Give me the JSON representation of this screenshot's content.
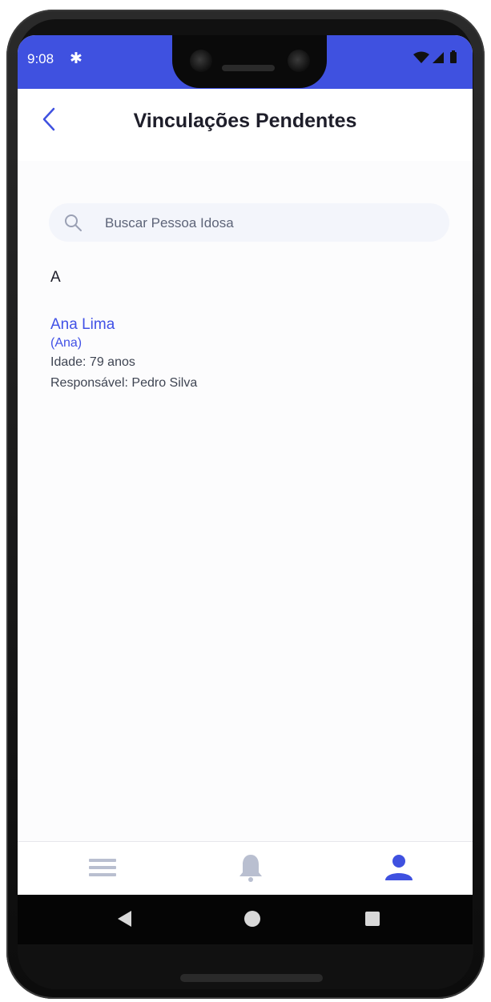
{
  "status_bar": {
    "time": "9:08",
    "settings_icon": "gear-icon",
    "right_icons": [
      "wifi-icon",
      "signal-icon",
      "battery-icon"
    ]
  },
  "header": {
    "title": "Vinculações Pendentes",
    "back_icon": "chevron-left-icon"
  },
  "search": {
    "placeholder": "Buscar Pessoa Idosa",
    "value": ""
  },
  "list": {
    "sections": [
      {
        "letter": "A",
        "items": [
          {
            "name": "Ana Lima",
            "nickname": "(Ana)",
            "age": "Idade: 79 anos",
            "responsible": "Responsável: Pedro Silva"
          }
        ]
      }
    ]
  },
  "bottom_nav": {
    "items": [
      {
        "icon": "menu-icon",
        "active": false
      },
      {
        "icon": "bell-icon",
        "active": false
      },
      {
        "icon": "user-icon",
        "active": true
      }
    ]
  },
  "colors": {
    "accent": "#3f51e0",
    "inactive_icon": "#b9bfd0",
    "text_primary": "#1e1e2a"
  }
}
